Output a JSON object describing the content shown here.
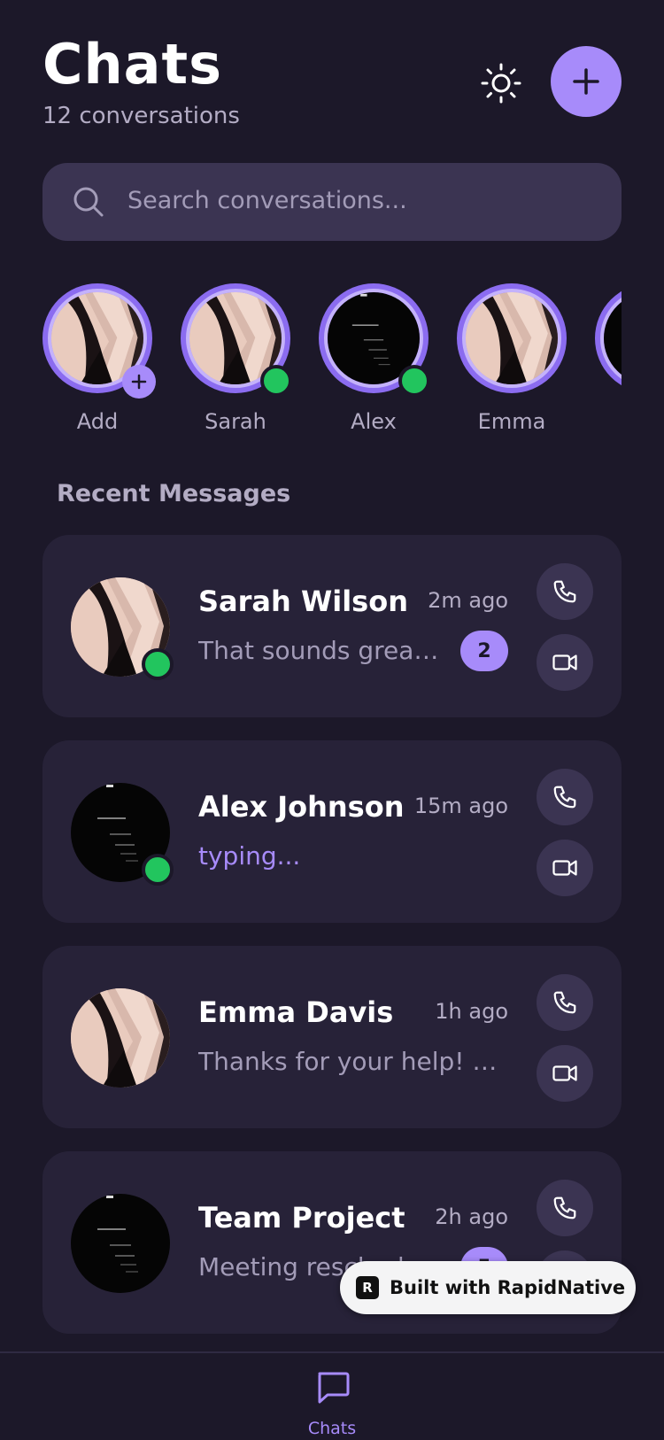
{
  "header": {
    "title": "Chats",
    "subtitle": "12 conversations"
  },
  "search": {
    "placeholder": "Search conversations..."
  },
  "stories": [
    {
      "name": "Add",
      "avatar": "cream-sculpture",
      "online": false,
      "add": true
    },
    {
      "name": "Sarah",
      "avatar": "cream-sculpture",
      "online": true
    },
    {
      "name": "Alex",
      "avatar": "dark-lines",
      "online": true
    },
    {
      "name": "Emma",
      "avatar": "cream-sculpture",
      "online": false
    },
    {
      "name": "",
      "avatar": "dark-lines",
      "online": false
    }
  ],
  "section_title": "Recent Messages",
  "chats": [
    {
      "name": "Sarah Wilson",
      "time": "2m ago",
      "message": "That sounds great! Let's meet tomorrow",
      "unread": "2",
      "online": true,
      "typing": false,
      "avatar": "cream-sculpture"
    },
    {
      "name": "Alex Johnson",
      "time": "15m ago",
      "message": "typing...",
      "unread": "",
      "online": true,
      "typing": true,
      "avatar": "dark-lines"
    },
    {
      "name": "Emma Davis",
      "time": "1h ago",
      "message": "Thanks for your help! Really appreciate it",
      "unread": "",
      "online": false,
      "typing": false,
      "avatar": "cream-sculpture"
    },
    {
      "name": "Team Project",
      "time": "2h ago",
      "message": "Meeting rescheduled",
      "unread": "5",
      "online": false,
      "typing": false,
      "avatar": "dark-lines"
    }
  ],
  "badge": {
    "label": "Built with RapidNative",
    "logo": "R"
  },
  "tabbar": {
    "chats_label": "Chats"
  },
  "colors": {
    "background": "#1c1829",
    "card": "#272238",
    "accent": "#a78bfa",
    "online": "#22c55e"
  },
  "icons": {
    "theme": "sun-icon",
    "new_chat": "plus-icon",
    "search": "search-icon",
    "call": "phone-icon",
    "video": "video-icon",
    "tab": "chat-bubble-icon"
  }
}
